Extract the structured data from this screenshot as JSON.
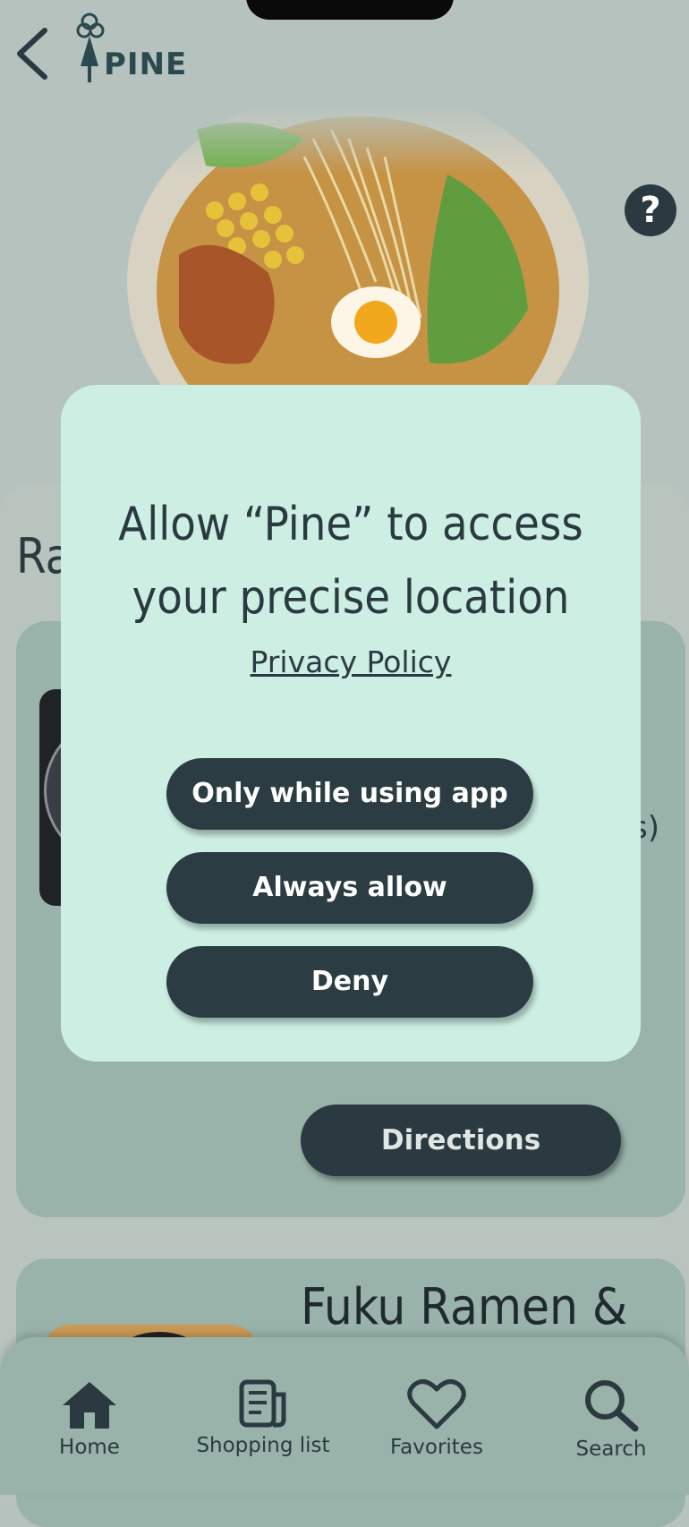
{
  "header": {
    "back_label": "Back",
    "logo_text": "PINE",
    "help_label": "?"
  },
  "hero": {
    "image": "ramen bowl"
  },
  "section": {
    "title_visible": "Ra"
  },
  "card1": {
    "side_text": "s)",
    "directions_label": "Directions"
  },
  "card2": {
    "title_visible": "Fuku Ramen &"
  },
  "modal": {
    "title_line1": "Allow “Pine” to access",
    "title_line2": "your precise location",
    "privacy_link": "Privacy Policy",
    "buttons": [
      "Only while using app",
      "Always allow",
      "Deny"
    ]
  },
  "tabbar": {
    "items": [
      {
        "label": "Home",
        "icon": "home-icon"
      },
      {
        "label": "Shopping list",
        "icon": "list-icon"
      },
      {
        "label": "Favorites",
        "icon": "heart-icon"
      },
      {
        "label": "Search",
        "icon": "search-icon"
      }
    ]
  },
  "colors": {
    "background": "#b6c2bd",
    "card": "#99b2aa",
    "modal": "#cceee3",
    "button": "#2b3d42"
  }
}
